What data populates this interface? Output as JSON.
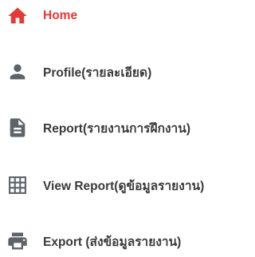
{
  "colors": {
    "active": "#e53935",
    "text": "#3a3a3a",
    "icon": "#5f6368"
  },
  "menu": {
    "items": [
      {
        "label": "Home",
        "icon": "home-icon",
        "active": true
      },
      {
        "label": "Profile(รายละเอียด)",
        "icon": "person-icon",
        "active": false
      },
      {
        "label": "Report(รายงานการฝึกงาน)",
        "icon": "document-icon",
        "active": false
      },
      {
        "label": "View Report(ดูข้อมูลรายงาน)",
        "icon": "grid-table-icon",
        "active": false
      },
      {
        "label": "Export (ส่งข้อมูลรายงาน)",
        "icon": "printer-icon",
        "active": false
      }
    ]
  }
}
